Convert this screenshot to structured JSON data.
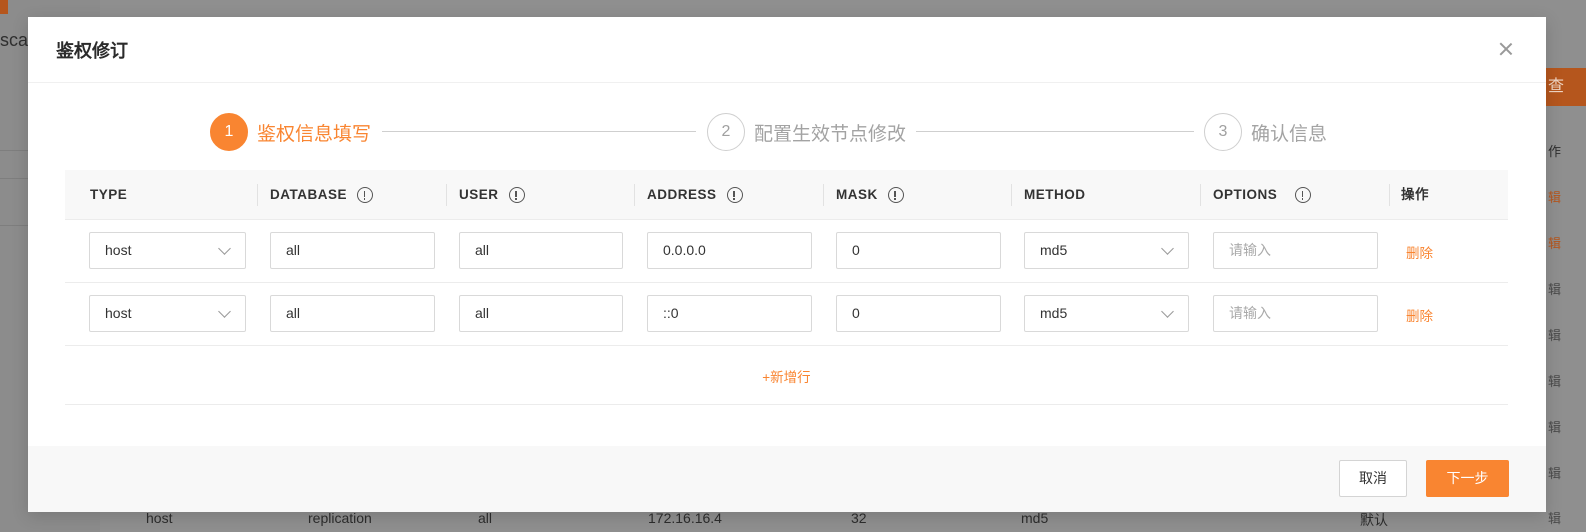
{
  "background": {
    "left_text": "sca",
    "right_button": "查",
    "right_cells": [
      "作",
      "辑",
      "辑",
      "辑",
      "辑",
      "辑",
      "辑",
      "辑",
      "辑"
    ],
    "bottom_row": [
      "host",
      "replication",
      "all",
      "172.16.16.4",
      "32",
      "md5",
      "默认",
      "编辑"
    ]
  },
  "modal": {
    "title": "鉴权修订",
    "steps": [
      {
        "number": "1",
        "label": "鉴权信息填写",
        "status": "active"
      },
      {
        "number": "2",
        "label": "配置生效节点修改",
        "status": "pending"
      },
      {
        "number": "3",
        "label": "确认信息",
        "status": "pending"
      }
    ],
    "table": {
      "columns": [
        "TYPE",
        "DATABASE",
        "USER",
        "ADDRESS",
        "MASK",
        "METHOD",
        "OPTIONS",
        "操作"
      ],
      "rows": [
        {
          "type": "host",
          "database": "all",
          "user": "all",
          "address": "0.0.0.0",
          "mask": "0",
          "method": "md5",
          "options_placeholder": "请输入",
          "delete_label": "删除"
        },
        {
          "type": "host",
          "database": "all",
          "user": "all",
          "address": "::0",
          "mask": "0",
          "method": "md5",
          "options_placeholder": "请输入",
          "delete_label": "删除"
        }
      ],
      "add_row_label": "+新增行"
    },
    "footer": {
      "cancel_label": "取消",
      "next_label": "下一步"
    }
  },
  "colors": {
    "accent": "#f98531",
    "overlay": "#8f8f8f"
  }
}
